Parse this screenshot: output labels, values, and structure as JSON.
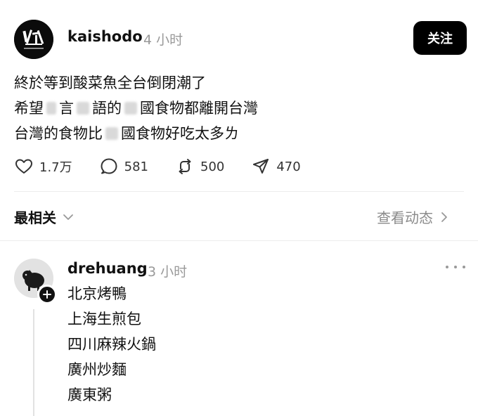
{
  "post": {
    "author": "kaishodo",
    "time": "4 小时",
    "follow_label": "关注",
    "lines": {
      "line1": "終於等到酸菜魚全台倒閉潮了",
      "line2_a": "希望",
      "line2_b": "言",
      "line2_c": "語的",
      "line2_d": "國食物都離開台灣",
      "line3_a": "台灣的食物比",
      "line3_b": "國食物好吃太多ㄌ"
    },
    "stats": {
      "likes": "1.7万",
      "comments": "581",
      "reposts": "500",
      "shares": "470"
    }
  },
  "sort": {
    "label": "最相关",
    "view_activity": "查看动态"
  },
  "reply": {
    "author": "drehuang",
    "time": "3 小时",
    "lines": [
      "北京烤鴨",
      "上海生煎包",
      "四川麻辣火鍋",
      "廣州炒麵",
      "廣東粥"
    ]
  },
  "icons": {
    "avatar": "brand-logo-avatar",
    "like": "heart-icon",
    "comment": "comment-bubble-icon",
    "repost": "repost-icon",
    "share": "send-icon",
    "sort": "chevron-down-icon",
    "view": "chevron-right-icon",
    "follow_badge": "plus-icon",
    "more": "more-dots-icon"
  },
  "colors": {
    "text": "#111111",
    "muted": "#999999",
    "button_bg": "#000000",
    "divider": "#ececec"
  }
}
